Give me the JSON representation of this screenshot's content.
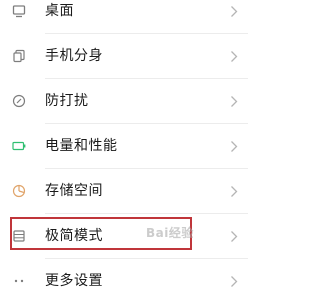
{
  "settings_list": {
    "items": [
      {
        "label": "桌面",
        "icon": "desktop-icon"
      },
      {
        "label": "手机分身",
        "icon": "phone-clone-icon"
      },
      {
        "label": "防打扰",
        "icon": "do-not-disturb-icon"
      },
      {
        "label": "电量和性能",
        "icon": "battery-icon"
      },
      {
        "label": "存储空间",
        "icon": "storage-icon"
      },
      {
        "label": "极简模式",
        "icon": "simple-mode-icon"
      },
      {
        "label": "更多设置",
        "icon": "more-icon"
      }
    ]
  },
  "highlight_color": "#c0353a",
  "icon_color": "#7d7d7d",
  "battery_accent": "#2fbf71",
  "storage_accent": "#e0a46a",
  "watermark": "Bai经验"
}
